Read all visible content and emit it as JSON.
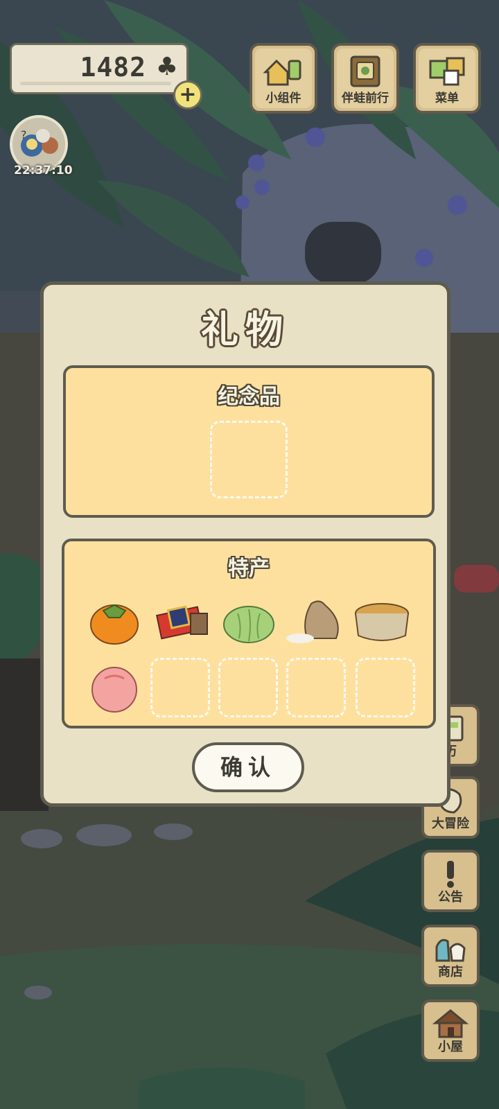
{
  "hud": {
    "clover_count": "1482",
    "clover_symbol": "♣",
    "add_symbol": "+",
    "time": "22:37:10"
  },
  "top_buttons": [
    {
      "label": "小组件",
      "icon": "widget-icon"
    },
    {
      "label": "伴蛙前行",
      "icon": "book-icon"
    },
    {
      "label": "菜单",
      "icon": "menu-icon"
    }
  ],
  "side_buttons": [
    {
      "label": "历",
      "icon": "calendar-icon"
    },
    {
      "label": "大冒险",
      "icon": "adventure-icon"
    },
    {
      "label": "公告",
      "icon": "exclamation-icon"
    },
    {
      "label": "商店",
      "icon": "shop-icon"
    },
    {
      "label": "小屋",
      "icon": "house-icon"
    }
  ],
  "dialog": {
    "title": "礼物",
    "souvenir": {
      "title": "纪念品",
      "slots": 1
    },
    "specialty": {
      "title": "特产",
      "items": [
        {
          "name": "persimmon"
        },
        {
          "name": "gift-box"
        },
        {
          "name": "cabbage"
        },
        {
          "name": "rice-bag"
        },
        {
          "name": "bean-basket"
        },
        {
          "name": "peach"
        }
      ],
      "empty_slots": 4
    },
    "confirm_label": "确认"
  },
  "colors": {
    "panel": "#e8e1c6",
    "section": "#fee09e",
    "border": "#5e5c4f",
    "button_wood": "#d7bf8e"
  }
}
